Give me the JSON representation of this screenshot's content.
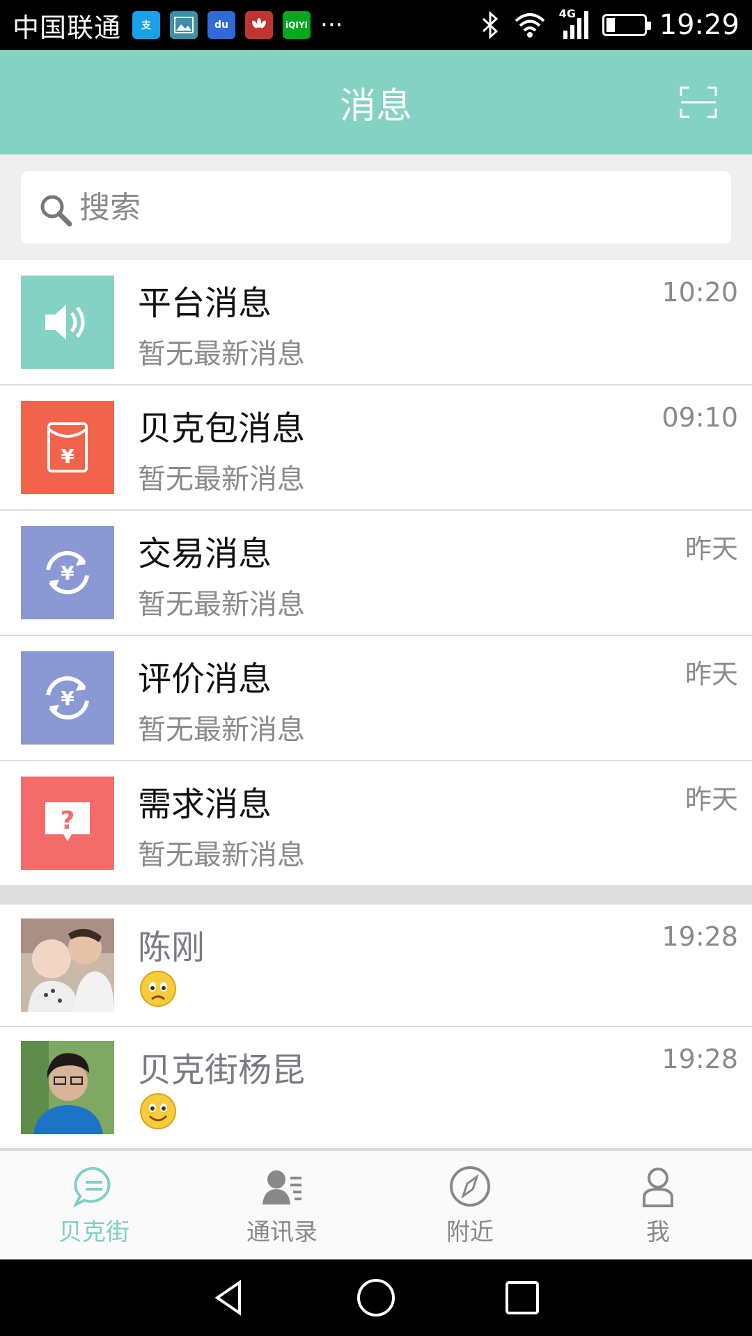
{
  "status_bar": {
    "carrier": "中国联通",
    "more": "···",
    "network": "4G",
    "time": "19:29"
  },
  "header": {
    "title": "消息"
  },
  "search": {
    "placeholder": "搜索"
  },
  "system_messages": [
    {
      "title": "平台消息",
      "subtitle": "暂无最新消息",
      "time": "10:20",
      "icon": "speaker-icon",
      "color": "#84d2c3"
    },
    {
      "title": "贝克包消息",
      "subtitle": "暂无最新消息",
      "time": "09:10",
      "icon": "red-envelope-icon",
      "color": "#f2634b"
    },
    {
      "title": "交易消息",
      "subtitle": "暂无最新消息",
      "time": "昨天",
      "icon": "yuan-exchange-icon",
      "color": "#8a99d4"
    },
    {
      "title": "评价消息",
      "subtitle": "暂无最新消息",
      "time": "昨天",
      "icon": "yuan-exchange-icon",
      "color": "#8a99d4"
    },
    {
      "title": "需求消息",
      "subtitle": "暂无最新消息",
      "time": "昨天",
      "icon": "question-bubble-icon",
      "color": "#f36b6b"
    }
  ],
  "chats": [
    {
      "name": "陈刚",
      "time": "19:28",
      "emoji": "worried-emoji-icon"
    },
    {
      "name": "贝克街杨昆",
      "time": "19:28",
      "emoji": "smile-emoji-icon"
    }
  ],
  "tabs": [
    {
      "label": "贝克街",
      "icon": "chat-bubble-icon",
      "active": true
    },
    {
      "label": "通讯录",
      "icon": "contacts-icon",
      "active": false
    },
    {
      "label": "附近",
      "icon": "compass-icon",
      "active": false
    },
    {
      "label": "我",
      "icon": "person-icon",
      "active": false
    }
  ],
  "colors": {
    "accent": "#84d2c3",
    "tab_active": "#7fd0c1"
  }
}
